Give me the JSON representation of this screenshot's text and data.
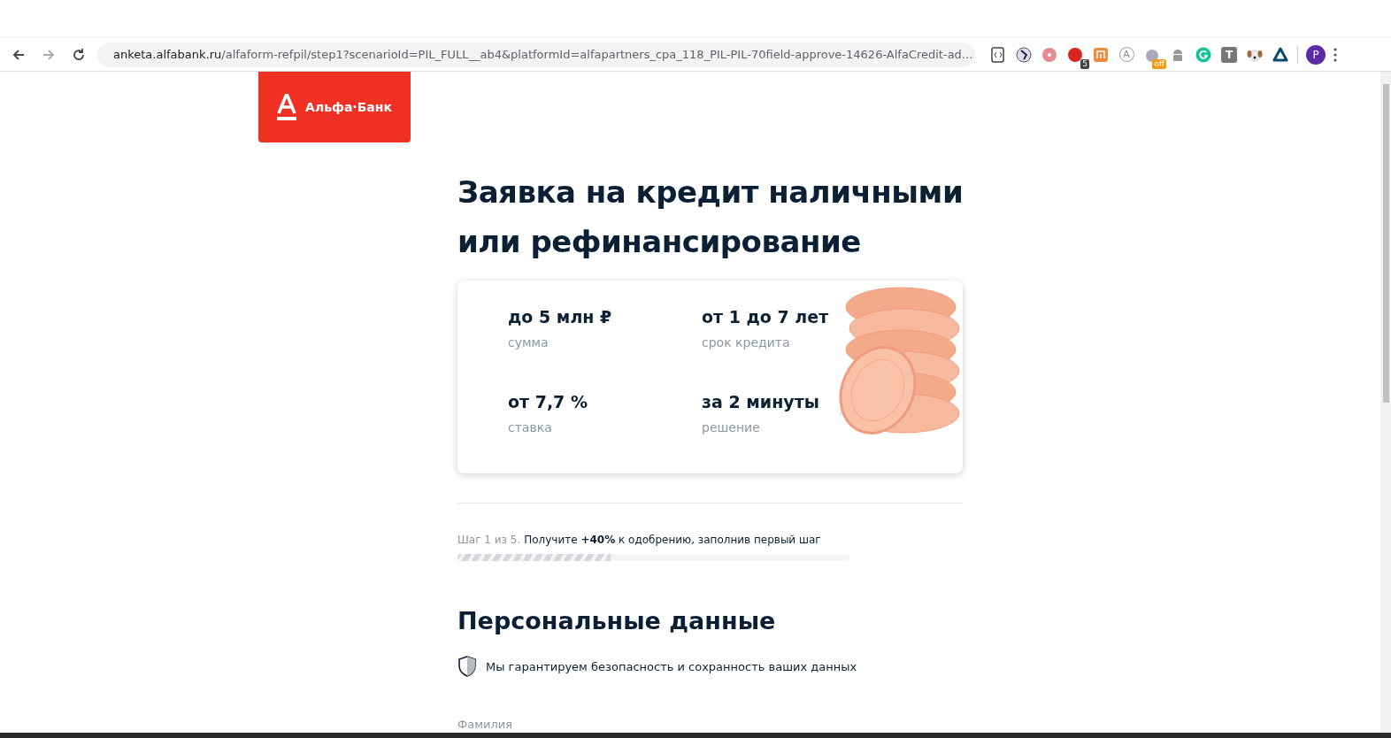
{
  "browser": {
    "url_host": "anketa.alfabank.ru",
    "url_path": "/alfaform-refpil/step1?scenarioId=PIL_FULL__ab4&platformId=alfapartners_cpa_118_PIL-PIL-70field-approve-14626-AlfaCredit-ad...",
    "extensions": [
      {
        "kind": "script"
      },
      {
        "kind": "figure"
      },
      {
        "kind": "dot"
      },
      {
        "kind": "badge-red",
        "badge": "5"
      },
      {
        "kind": "mi"
      },
      {
        "kind": "letter-circle",
        "glyph": "A"
      },
      {
        "kind": "badge-off",
        "badge": "off"
      },
      {
        "kind": "android"
      },
      {
        "kind": "grammar"
      },
      {
        "kind": "letter-square",
        "glyph": "T"
      },
      {
        "kind": "dog"
      },
      {
        "kind": "triangle"
      }
    ],
    "profile": "P"
  },
  "logo": {
    "text": "Альфа·Банк"
  },
  "title": "Заявка на кредит наличными или рефинансирование",
  "features": [
    {
      "value": "до 5 млн ₽",
      "label": "сумма"
    },
    {
      "value": "от 1 до 7 лет",
      "label": "срок кредита"
    },
    {
      "value": "от 7,7 %",
      "label": "ставка"
    },
    {
      "value": "за 2 минуты",
      "label": "решение"
    }
  ],
  "progress": {
    "step": "Шаг 1 из 5.",
    "text": "Получите **+40%** к одобрению, заполнив первый шаг",
    "level": 0.39
  },
  "section": {
    "title": "Персональные данные",
    "notice": "Мы гарантируем безопасность и сохранность ваших данных"
  },
  "fields": [
    {
      "label": "Фамилия"
    }
  ]
}
